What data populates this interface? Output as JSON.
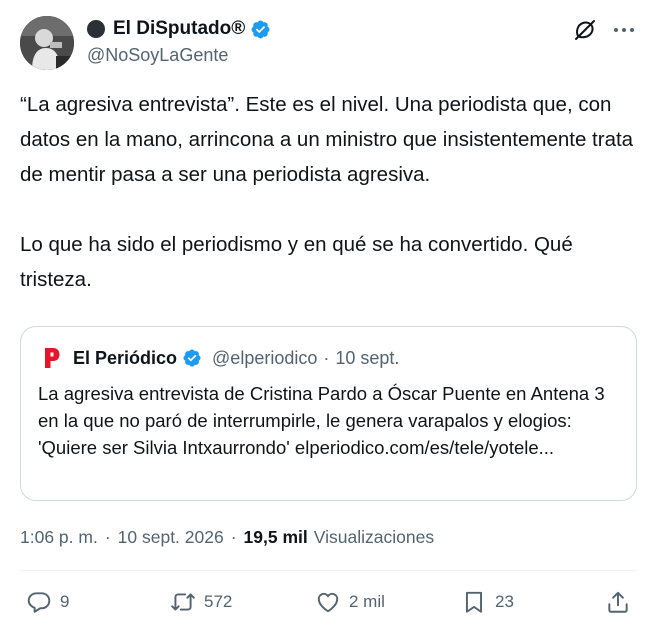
{
  "author": {
    "name": "El DiSputado®",
    "handle": "@NoSoyLaGente",
    "verified_icon": "verified-badge-icon",
    "avatar": "avatar-photo"
  },
  "header_icons": [
    "grok-icon",
    "more-icon"
  ],
  "tweet": {
    "text": "“La agresiva entrevista”. Este es el nivel. Una periodista que, con datos en la mano, arrincona a un ministro que insistentemente trata de mentir pasa a ser una periodista agresiva.\n\nLo que ha sido el periodismo y en qué se ha convertido. Qué tristeza."
  },
  "quote": {
    "logo_icon": "el-periodico-logo-icon",
    "name": "El Periódico",
    "handle": "@elperiodico",
    "separator": "·",
    "date": "10 sept.",
    "text": "La agresiva entrevista de Cristina Pardo a Óscar Puente en Antena 3 en la que no paró de interrumpirle, le genera varapalos y elogios: 'Quiere ser Silvia Intxaurrondo' elperiodico.com/es/tele/yotele..."
  },
  "meta": {
    "time": "1:06 p. m.",
    "separator": "·",
    "date": "10 sept. 2026",
    "views_count": "19,5 mil",
    "views_label": "Visualizaciones"
  },
  "actions": {
    "replies": "9",
    "retweets": "572",
    "likes": "2 mil",
    "bookmarks": "23"
  },
  "colors": {
    "text": "#0f1419",
    "secondary": "#536471",
    "verified": "#1d9bf0",
    "border": "#cfd9de",
    "logo_red": "#e4162b"
  }
}
